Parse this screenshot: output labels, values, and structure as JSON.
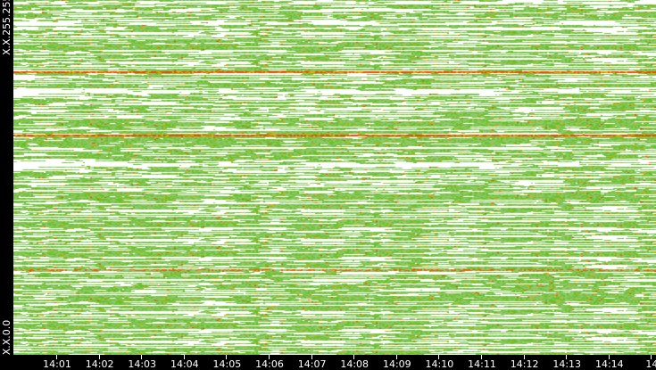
{
  "chart_data": {
    "type": "heatmap",
    "title": "",
    "xlabel": "",
    "ylabel": "",
    "y_tick_labels": [
      "X.X.255.255",
      "X.X.0.0"
    ],
    "x_tick_labels": [
      "14:01",
      "14:02",
      "14:03",
      "14:04",
      "14:05",
      "14:06",
      "14:07",
      "14:08",
      "14:09",
      "14:10",
      "14:11",
      "14:12",
      "14:13",
      "14:14",
      "14"
    ],
    "color_scale": [
      "#ffffff",
      "#8dc86a",
      "#6cbf2a",
      "#f0a000",
      "#e84a00"
    ],
    "notable_rows": [
      {
        "y_fraction_from_top": 0.38,
        "level": "high"
      },
      {
        "y_fraction_from_top": 0.2,
        "level": "high"
      },
      {
        "y_fraction_from_top": 0.76,
        "level": "medium"
      }
    ]
  }
}
